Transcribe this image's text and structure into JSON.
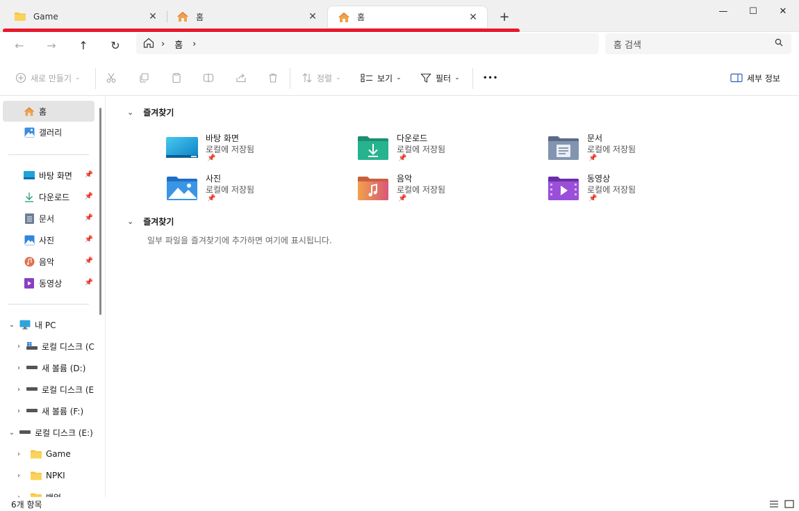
{
  "tabs": [
    {
      "label": "Game",
      "icon": "folder-icon",
      "active": false
    },
    {
      "label": "홈",
      "icon": "home-icon",
      "active": false
    },
    {
      "label": "홈",
      "icon": "home-icon",
      "active": true
    }
  ],
  "tab_add": "+",
  "window_controls": {
    "minimize": "—",
    "maximize": "☐",
    "close": "✕"
  },
  "nav": {
    "back": "←",
    "forward": "→",
    "up": "↑",
    "refresh": "↻",
    "breadcrumb": [
      "홈"
    ],
    "separator": "›"
  },
  "search": {
    "placeholder": "홈 검색"
  },
  "commands": {
    "new": "새로 만들기",
    "sort": "정렬",
    "view": "보기",
    "filter": "필터",
    "more": "•••",
    "details": "세부 정보"
  },
  "sidebar": {
    "home": "홈",
    "gallery": "갤러리",
    "quick_access": [
      {
        "label": "바탕 화면",
        "icon": "desktop-icon"
      },
      {
        "label": "다운로드",
        "icon": "download-icon"
      },
      {
        "label": "문서",
        "icon": "documents-icon"
      },
      {
        "label": "사진",
        "icon": "pictures-icon"
      },
      {
        "label": "음악",
        "icon": "music-icon"
      },
      {
        "label": "동영상",
        "icon": "videos-icon"
      }
    ],
    "this_pc": "내 PC",
    "drives": [
      {
        "label": "로컬 디스크 (C:)"
      },
      {
        "label": "새 볼륨 (D:)"
      },
      {
        "label": "로컬 디스크 (E:)"
      },
      {
        "label": "새 볼륨 (F:)"
      }
    ],
    "expanded_drive": "로컬 디스크 (E:)",
    "folders": [
      {
        "label": "Game"
      },
      {
        "label": "NPKI"
      },
      {
        "label": "백업"
      }
    ]
  },
  "main": {
    "favorites_header": "즐겨찾기",
    "tiles": [
      {
        "name": "바탕 화면",
        "sub": "로컬에 저장됨",
        "icon": "desktop-folder-icon"
      },
      {
        "name": "다운로드",
        "sub": "로컬에 저장됨",
        "icon": "downloads-folder-icon"
      },
      {
        "name": "문서",
        "sub": "로컬에 저장됨",
        "icon": "documents-folder-icon"
      },
      {
        "name": "사진",
        "sub": "로컬에 저장됨",
        "icon": "pictures-folder-icon"
      },
      {
        "name": "음악",
        "sub": "로컬에 저장됨",
        "icon": "music-folder-icon"
      },
      {
        "name": "동영상",
        "sub": "로컬에 저장됨",
        "icon": "videos-folder-icon"
      }
    ],
    "favorites_header_2": "즐겨찾기",
    "empty_message": "일부 파일을 즐겨찾기에 추가하면 여기에 표시됩니다."
  },
  "status": {
    "item_count": "6개 항목"
  },
  "colors": {
    "accent_red": "#e8192c",
    "selection": "#e4e4e4",
    "folder_yellow": "#f5c542"
  }
}
